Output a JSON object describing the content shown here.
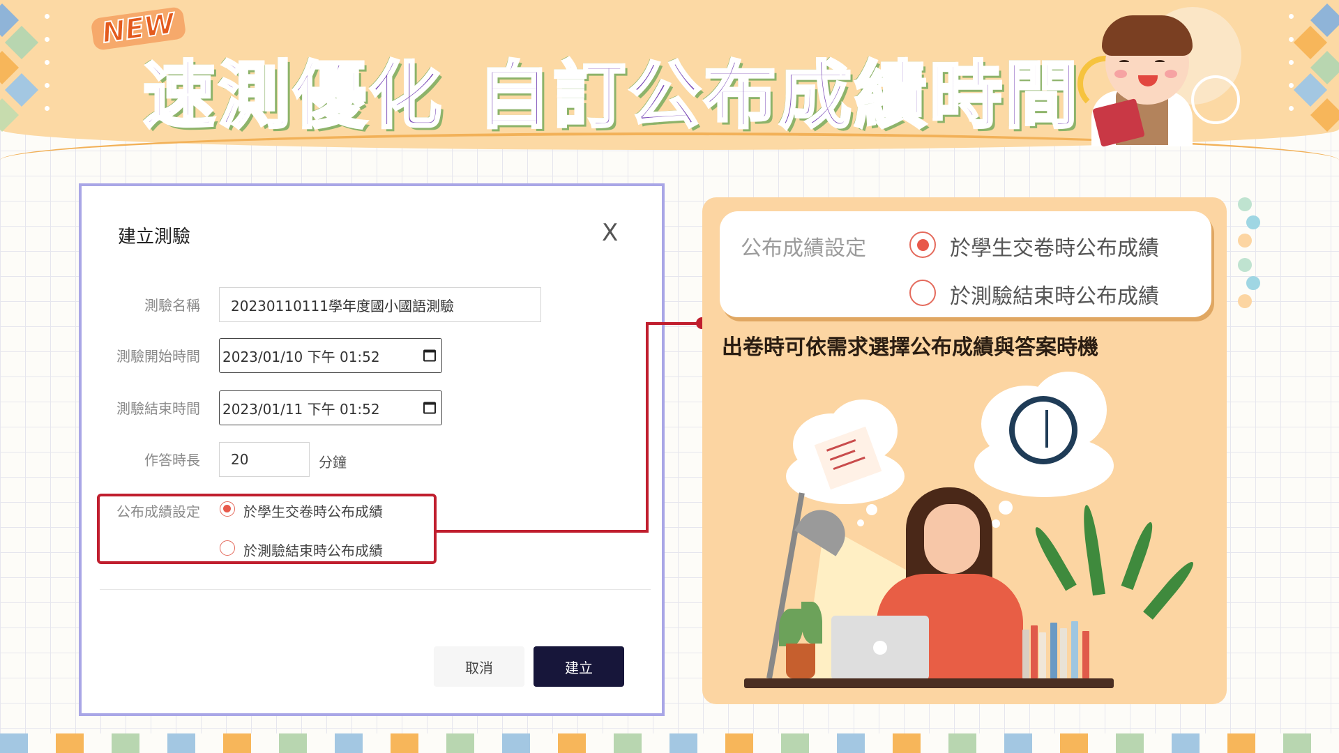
{
  "banner": {
    "badge": "NEW",
    "title_part1": "速測優化",
    "title_part2": "自訂公布成績時間"
  },
  "dialog": {
    "title": "建立測驗",
    "close_symbol": "X",
    "fields": {
      "name_label": "測驗名稱",
      "name_value": "20230110111學年度國小國語測驗",
      "start_label": "測驗開始時間",
      "start_value": "2023/01/10 下午 01:52",
      "end_label": "測驗結束時間",
      "end_value": "2023/01/11 下午 01:52",
      "duration_label": "作答時長",
      "duration_value": "20",
      "duration_unit": "分鐘",
      "publish_label": "公布成績設定",
      "publish_option_1": "於學生交卷時公布成績",
      "publish_option_2": "於測驗結束時公布成績"
    },
    "buttons": {
      "cancel": "取消",
      "create": "建立"
    }
  },
  "callout": {
    "label": "公布成績設定",
    "option_1": "於學生交卷時公布成績",
    "option_2": "於測驗結束時公布成績",
    "caption": "出卷時可依需求選擇公布成績與答案時機"
  },
  "colors": {
    "banner_bg": "#fcd9a4",
    "title_purple": "#7b4bb8",
    "title_shadow_green": "#8db36a",
    "highlight_red": "#c01e2e",
    "radio_accent": "#e8584a",
    "create_button": "#17163a",
    "panel_peach": "#fcd5a2",
    "dialog_border": "#a9a6e6"
  },
  "icons": [
    "close-icon",
    "calendar-icon",
    "clock-icon",
    "radio-selected-icon",
    "radio-unselected-icon"
  ]
}
